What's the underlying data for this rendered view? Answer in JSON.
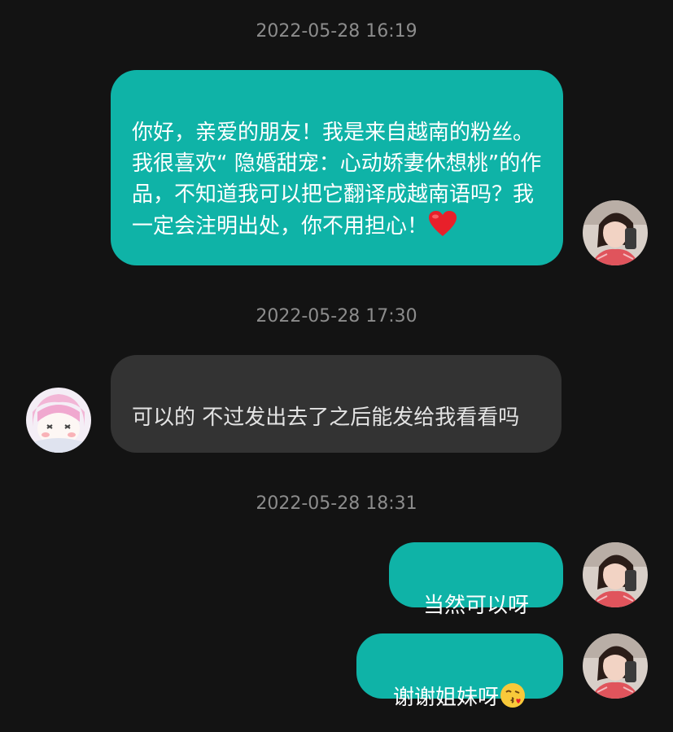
{
  "messages": [
    {
      "timestamp": "2022-05-28 16:19",
      "sender": "self",
      "text": "你好，亲爱的朋友！我是来自越南的粉丝。我很喜欢“ 隐婚甜宠：心动娇妻休想桃”的作品，不知道我可以把它翻译成越南语吗？我一定会注明出处，你不用担心！",
      "emoji": "red-heart"
    },
    {
      "timestamp": "2022-05-28 17:30",
      "sender": "other",
      "text": "可以的 不过发出去了之后能发给我看看吗"
    },
    {
      "timestamp": "2022-05-28 18:31",
      "sender": "self",
      "text": "当然可以呀"
    },
    {
      "sender": "self",
      "text": "谢谢姐妹呀",
      "emoji": "face-blowing-kiss"
    }
  ],
  "colors": {
    "background": "#131313",
    "outgoing_bubble": "#0fb3a7",
    "incoming_bubble": "#333333",
    "timestamp_text": "#8c8c8c"
  }
}
